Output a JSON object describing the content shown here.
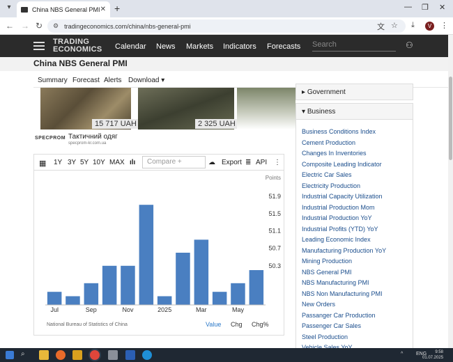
{
  "browser": {
    "tab_title": "China NBS General PMI",
    "url": "tradingeconomics.com/china/nbs-general-pmi"
  },
  "site": {
    "logo_line1": "TRADING",
    "logo_line2": "ECONOMICS",
    "nav": [
      "Calendar",
      "News",
      "Markets",
      "Indicators",
      "Forecasts"
    ],
    "search_placeholder": "Search"
  },
  "page": {
    "title": "China NBS General PMI",
    "subnav": [
      "Summary",
      "Forecast",
      "Alerts",
      "Download"
    ]
  },
  "ad": {
    "price1": "15 717 UAH",
    "price2": "2 325 UAH",
    "brand_logo": "SPECPROM",
    "title": "Тактичний одяг",
    "url": "specprom-kr.com.ua"
  },
  "toolbar": {
    "ranges": [
      "1Y",
      "3Y",
      "5Y",
      "10Y",
      "MAX"
    ],
    "compare_placeholder": "Compare +",
    "export_label": "Export",
    "api_label": "API"
  },
  "chart_data": {
    "type": "bar",
    "ylabel": "Points",
    "ylim": [
      49.4,
      52.2
    ],
    "yticks": [
      50.3,
      50.7,
      51.1,
      51.5,
      51.9
    ],
    "x_tick_labels": [
      "Jul",
      "Sep",
      "Nov",
      "2025",
      "Mar",
      "May"
    ],
    "x_tick_index": [
      0,
      2,
      4,
      6,
      8,
      10
    ],
    "values": [
      49.7,
      49.6,
      49.9,
      50.3,
      50.3,
      51.7,
      49.6,
      50.6,
      50.9,
      49.7,
      49.9,
      50.2
    ],
    "source": "National Bureau of Statistics of China",
    "legend": [
      "Value",
      "Chg",
      "Chg%"
    ],
    "bar_color": "#4a7fc1",
    "grid": false
  },
  "sidebar": {
    "section1": "Government",
    "section2": "Business",
    "items": [
      "Business Conditions Index",
      "Cement Production",
      "Changes In Inventories",
      "Composite Leading Indicator",
      "Electric Car Sales",
      "Electricity Production",
      "Industrial Capacity Utilization",
      "Industrial Production Mom",
      "Industrial Production YoY",
      "Industrial Profits (YTD) YoY",
      "Leading Economic Index",
      "Manufacturing Production YoY",
      "Mining Production",
      "NBS General PMI",
      "NBS Manufacturing PMI",
      "NBS Non Manufacturing PMI",
      "New Orders",
      "Passanger Car Production",
      "Passenger Car Sales",
      "Steel Production",
      "Vehicle Sales YoY"
    ]
  },
  "taskbar": {
    "lang": "ENG",
    "time": "9:58",
    "date": "01.07.2025"
  }
}
